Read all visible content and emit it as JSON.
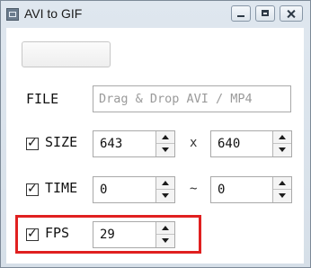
{
  "window": {
    "title": "AVI to GIF",
    "icons": {
      "app": "app-icon",
      "minimize": "minimize-icon",
      "maximize": "maximize-icon",
      "close": "close-icon"
    }
  },
  "file": {
    "label": "FILE",
    "placeholder": "Drag & Drop AVI / MP4"
  },
  "rows": [
    {
      "label": "SIZE",
      "checked": true,
      "value1": "643",
      "separator": "x",
      "value2": "640"
    },
    {
      "label": "TIME",
      "checked": true,
      "value1": "0",
      "separator": "~",
      "value2": "0"
    },
    {
      "label": "FPS",
      "checked": true,
      "value1": "29"
    }
  ],
  "checkbox_mark": "✓",
  "highlight_color": "#e02020"
}
